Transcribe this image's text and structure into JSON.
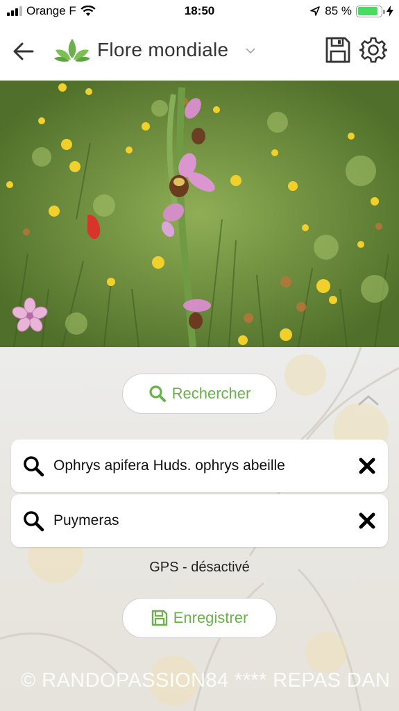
{
  "status_bar": {
    "carrier": "Orange F",
    "time": "18:50",
    "battery": "85 %",
    "battery_level": 0.85,
    "icons": [
      "signal-icon",
      "wifi-icon",
      "location-arrow-icon",
      "battery-icon",
      "charging-icon"
    ]
  },
  "header": {
    "title": "Flore mondiale",
    "icons": [
      "back-arrow-icon",
      "leaf-logo-icon",
      "chevron-down-icon",
      "floppy-disk-icon",
      "gear-icon"
    ]
  },
  "photo": {
    "icons": [
      "flower-badge-icon"
    ]
  },
  "actions": {
    "search_label": "Rechercher",
    "save_label": "Enregistrer",
    "icons": [
      "search-icon",
      "chevron-up-icon",
      "floppy-disk-icon"
    ]
  },
  "fields": [
    {
      "value": "Ophrys apifera Huds. ophrys abeille"
    },
    {
      "value": "Puymeras"
    }
  ],
  "gps_status": "GPS - désactivé",
  "watermark": "© RANDOPASSION84 ****   REPAS DAN",
  "colors": {
    "accent": "#6ab04c",
    "battery": "#4cd964"
  }
}
